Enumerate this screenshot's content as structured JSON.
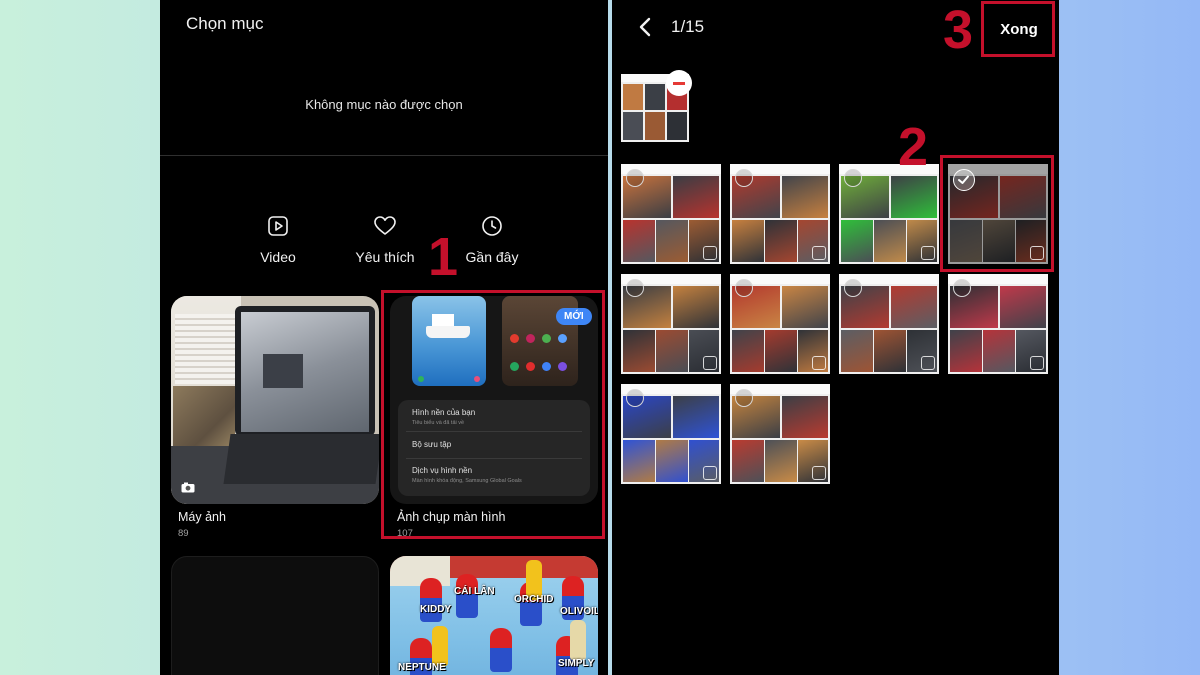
{
  "left": {
    "header_title": "Chọn mục",
    "empty_text": "Không mục nào được chọn",
    "shortcuts": [
      {
        "label": "Video",
        "icon": "video-icon"
      },
      {
        "label": "Yêu thích",
        "icon": "heart-icon"
      },
      {
        "label": "Gần đây",
        "icon": "clock-icon"
      }
    ],
    "albums": [
      {
        "name": "Máy ảnh",
        "count": "89"
      },
      {
        "name": "Ảnh chụp màn hình",
        "count": "107"
      }
    ],
    "screenshot_preview": {
      "badge": "MỚI",
      "menu": [
        {
          "title": "Hình nền của bạn",
          "sub": "Tiêu biểu và đã tải về"
        },
        {
          "title": "Bộ sưu tập",
          "sub": ""
        },
        {
          "title": "Dịch vụ hình nền",
          "sub": "Màn hình khóa động, Samsung Global Goals"
        }
      ]
    },
    "meme_labels": [
      "KIDDY",
      "CÁI LÂN",
      "ORCHID",
      "OLIVOILA",
      "NEPTUNE",
      "SIMPLY"
    ]
  },
  "right": {
    "counter": "1/15",
    "done_label": "Xong"
  },
  "steps": [
    "1",
    "2",
    "3"
  ],
  "colors": {
    "accent_red": "#c4102b",
    "badge_blue": "#3e86f6",
    "panel_bg": "#000000"
  }
}
